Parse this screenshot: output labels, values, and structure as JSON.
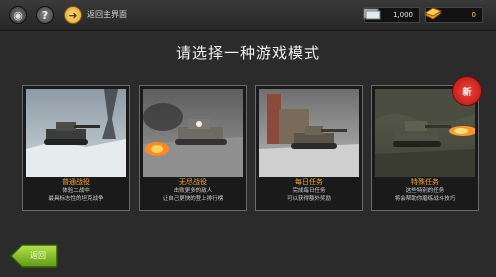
{
  "topbar": {
    "main_menu": "返回主界面",
    "silver": "1,000",
    "gold": "0"
  },
  "title": "请选择一种游戏模式",
  "modes": [
    {
      "title": "普通战役",
      "desc1": "体验二战中",
      "desc2": "最具标志性的坦克战争"
    },
    {
      "title": "无尽战役",
      "desc1": "击败更多的敌人",
      "desc2": "让自己更快的登上排行榜"
    },
    {
      "title": "每日任务",
      "desc1": "完成每日任务",
      "desc2": "可以获得额外奖励"
    },
    {
      "title": "特殊任务",
      "desc1": "这些特别的任务",
      "desc2": "将会帮助你磨练战斗技巧"
    }
  ],
  "new_badge": "新",
  "back_button": "返回",
  "icons": [
    "logo-icon",
    "help-icon",
    "home-icon",
    "silver-icon",
    "gold-icon"
  ]
}
